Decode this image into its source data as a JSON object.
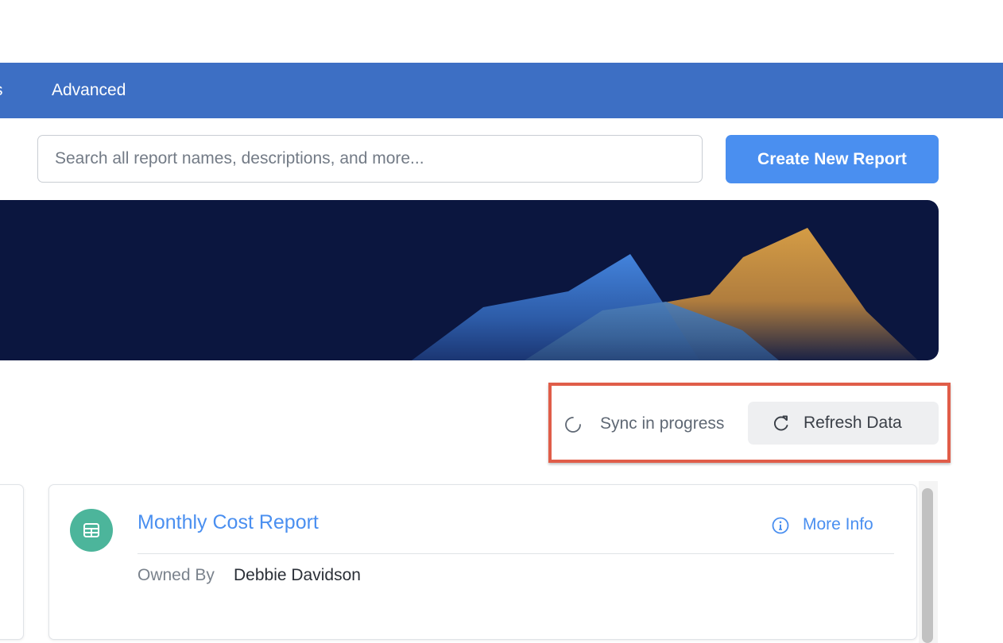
{
  "nav": {
    "partial_label": "s",
    "advanced_label": "Advanced"
  },
  "search": {
    "placeholder": "Search all report names, descriptions, and more..."
  },
  "toolbar": {
    "create_label": "Create New Report"
  },
  "sync": {
    "status_text": "Sync in progress",
    "refresh_label": "Refresh Data"
  },
  "report": {
    "title": "Monthly Cost Report",
    "more_info_label": "More Info",
    "owned_by_label": "Owned By",
    "owner_name": "Debbie Davidson"
  },
  "colors": {
    "nav_bg": "#3d6fc4",
    "accent": "#4a8ff0",
    "hero_bg": "#0b163f",
    "highlight_frame": "#e05d49",
    "report_icon_bg": "#4cb59b"
  },
  "icons": {
    "spinner": "loading-spinner-icon",
    "refresh": "refresh-icon",
    "info": "info-circle-icon",
    "report": "table-icon"
  }
}
